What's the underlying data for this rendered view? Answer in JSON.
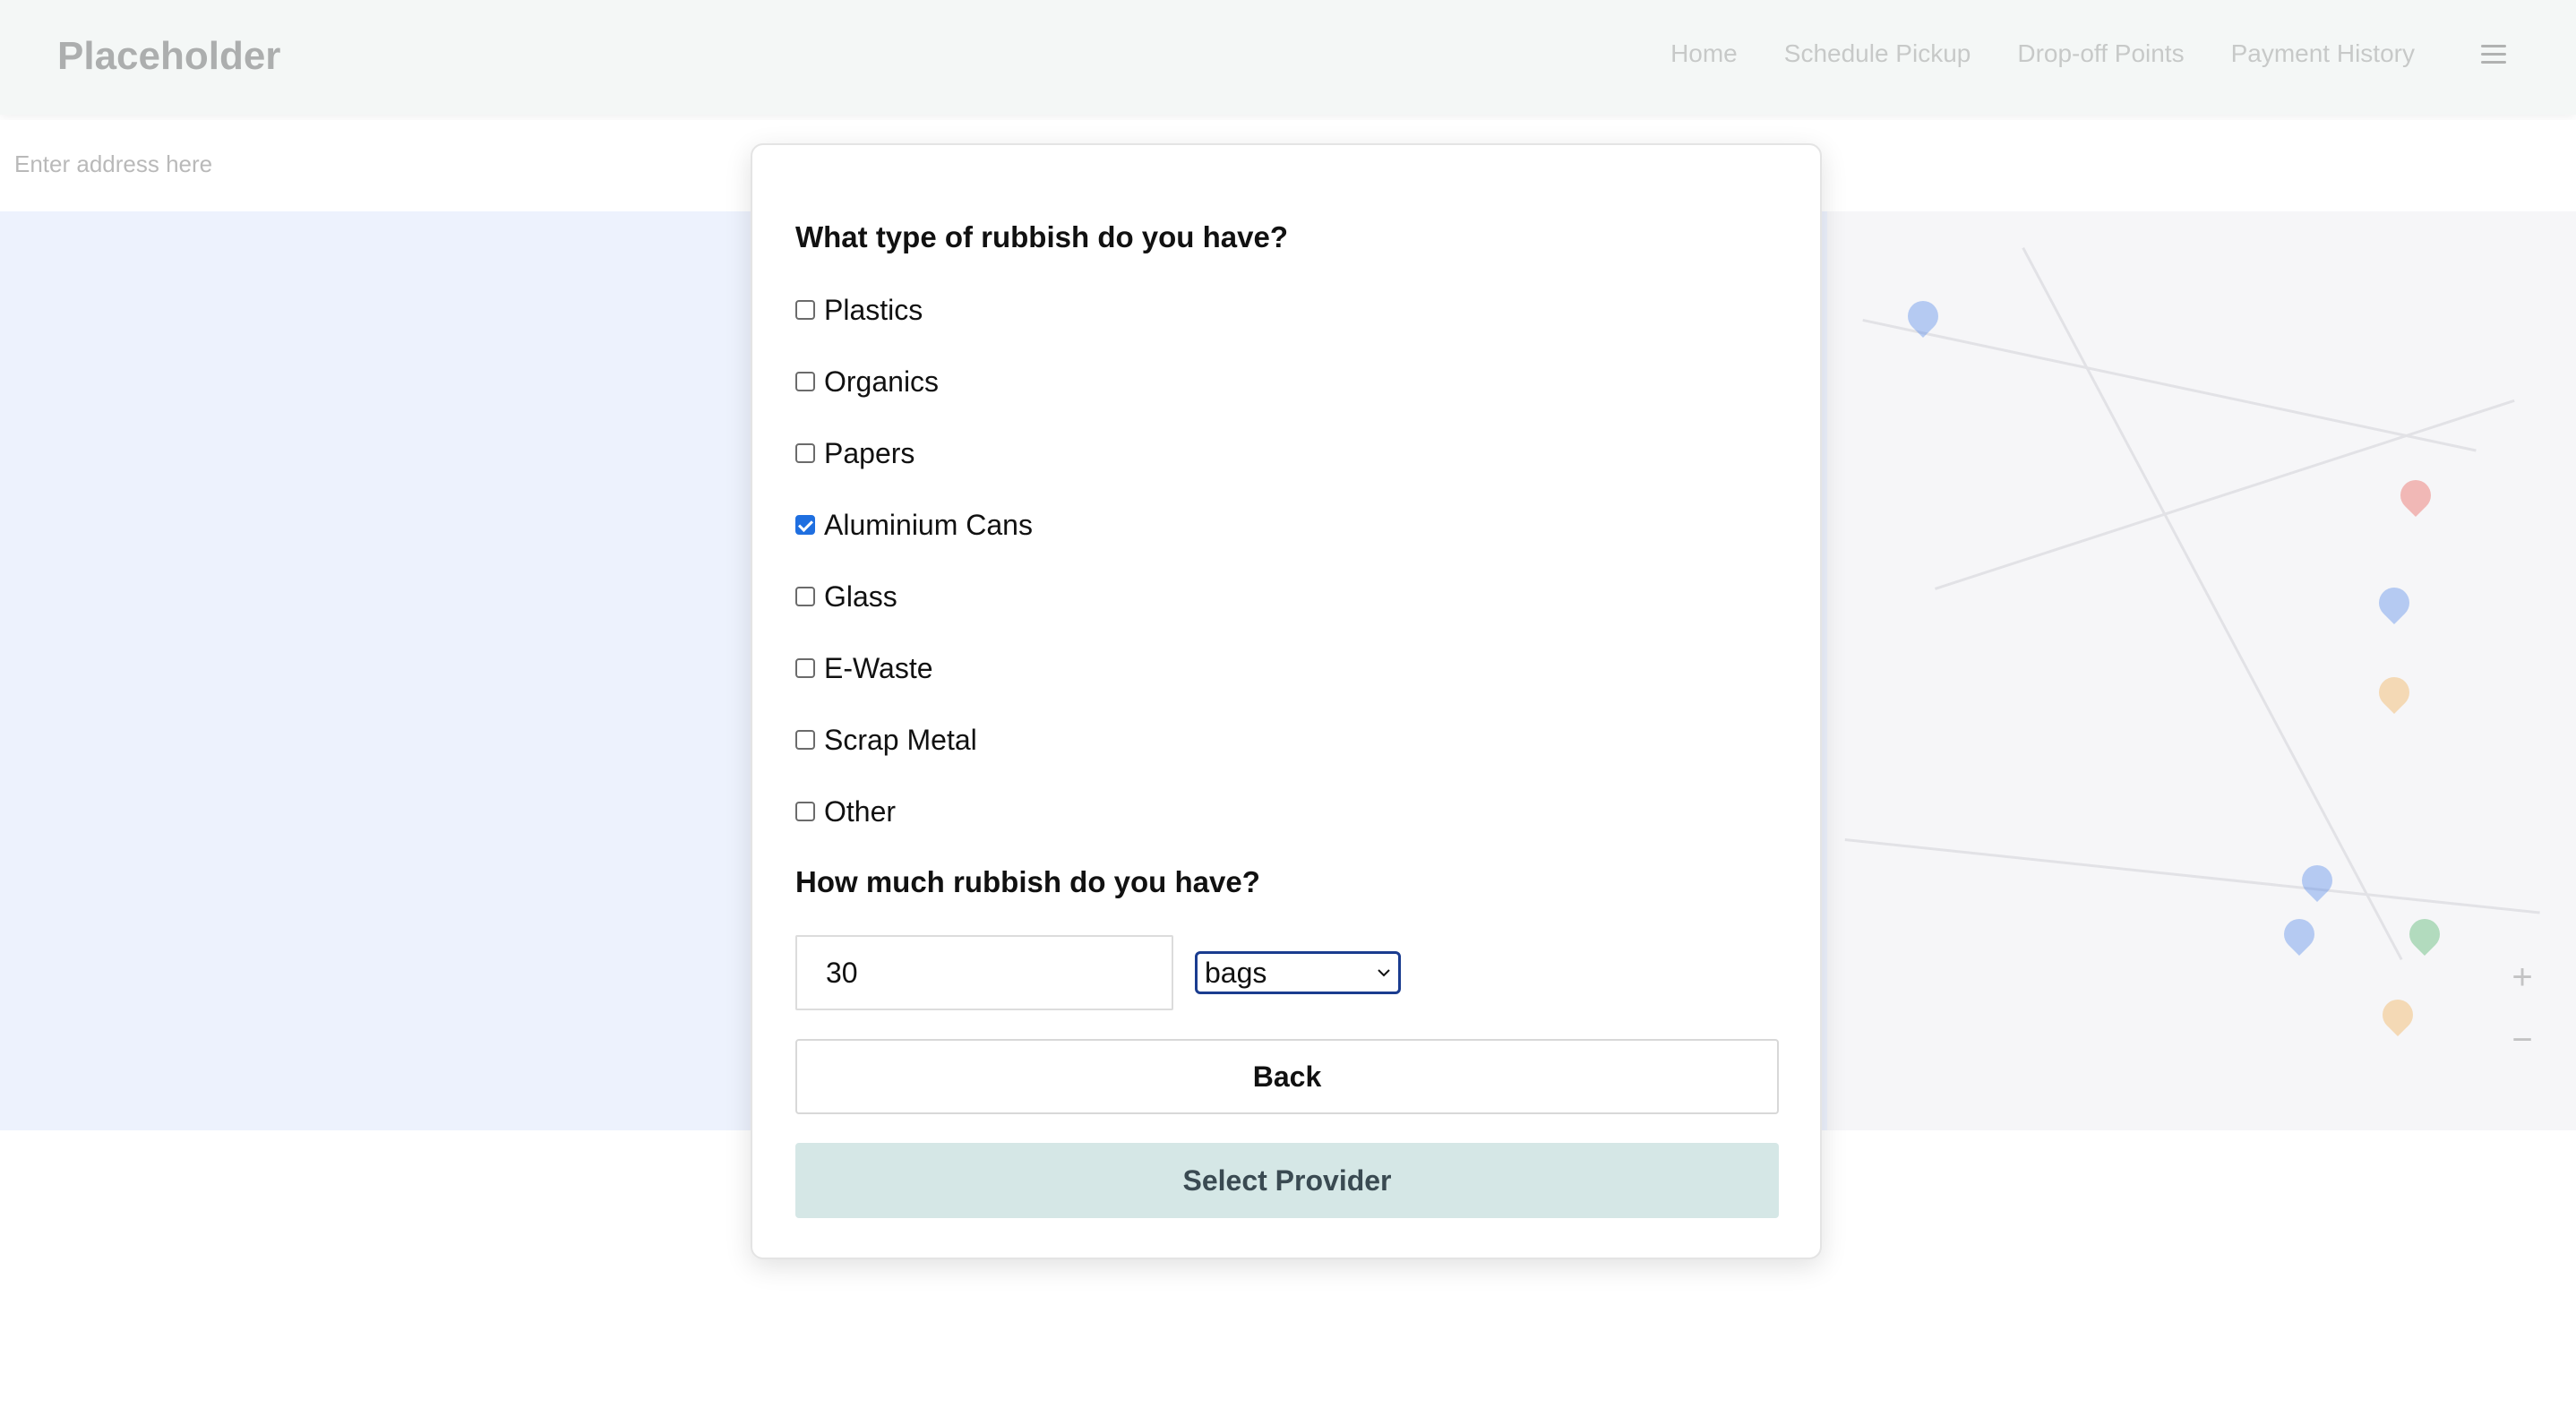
{
  "navbar": {
    "brand": "Placeholder",
    "links": [
      "Home",
      "Schedule Pickup",
      "Drop-off Points",
      "Payment History"
    ]
  },
  "search": {
    "placeholder": "Enter address here"
  },
  "modal": {
    "question_type": "What type of rubbish do you have?",
    "options": [
      {
        "label": "Plastics",
        "checked": false
      },
      {
        "label": "Organics",
        "checked": false
      },
      {
        "label": "Papers",
        "checked": false
      },
      {
        "label": "Aluminium Cans",
        "checked": true
      },
      {
        "label": "Glass",
        "checked": false
      },
      {
        "label": "E-Waste",
        "checked": false
      },
      {
        "label": "Scrap Metal",
        "checked": false
      },
      {
        "label": "Other",
        "checked": false
      }
    ],
    "question_amount": "How much rubbish do you have?",
    "quantity_value": "30",
    "unit_selected": "bags",
    "back_label": "Back",
    "select_provider_label": "Select Provider"
  },
  "colors": {
    "checkbox_checked": "#1f6fe0",
    "select_provider_bg": "#d5e7e6",
    "select_border": "#1a3c8f",
    "map_bg": "#edf2fd"
  }
}
